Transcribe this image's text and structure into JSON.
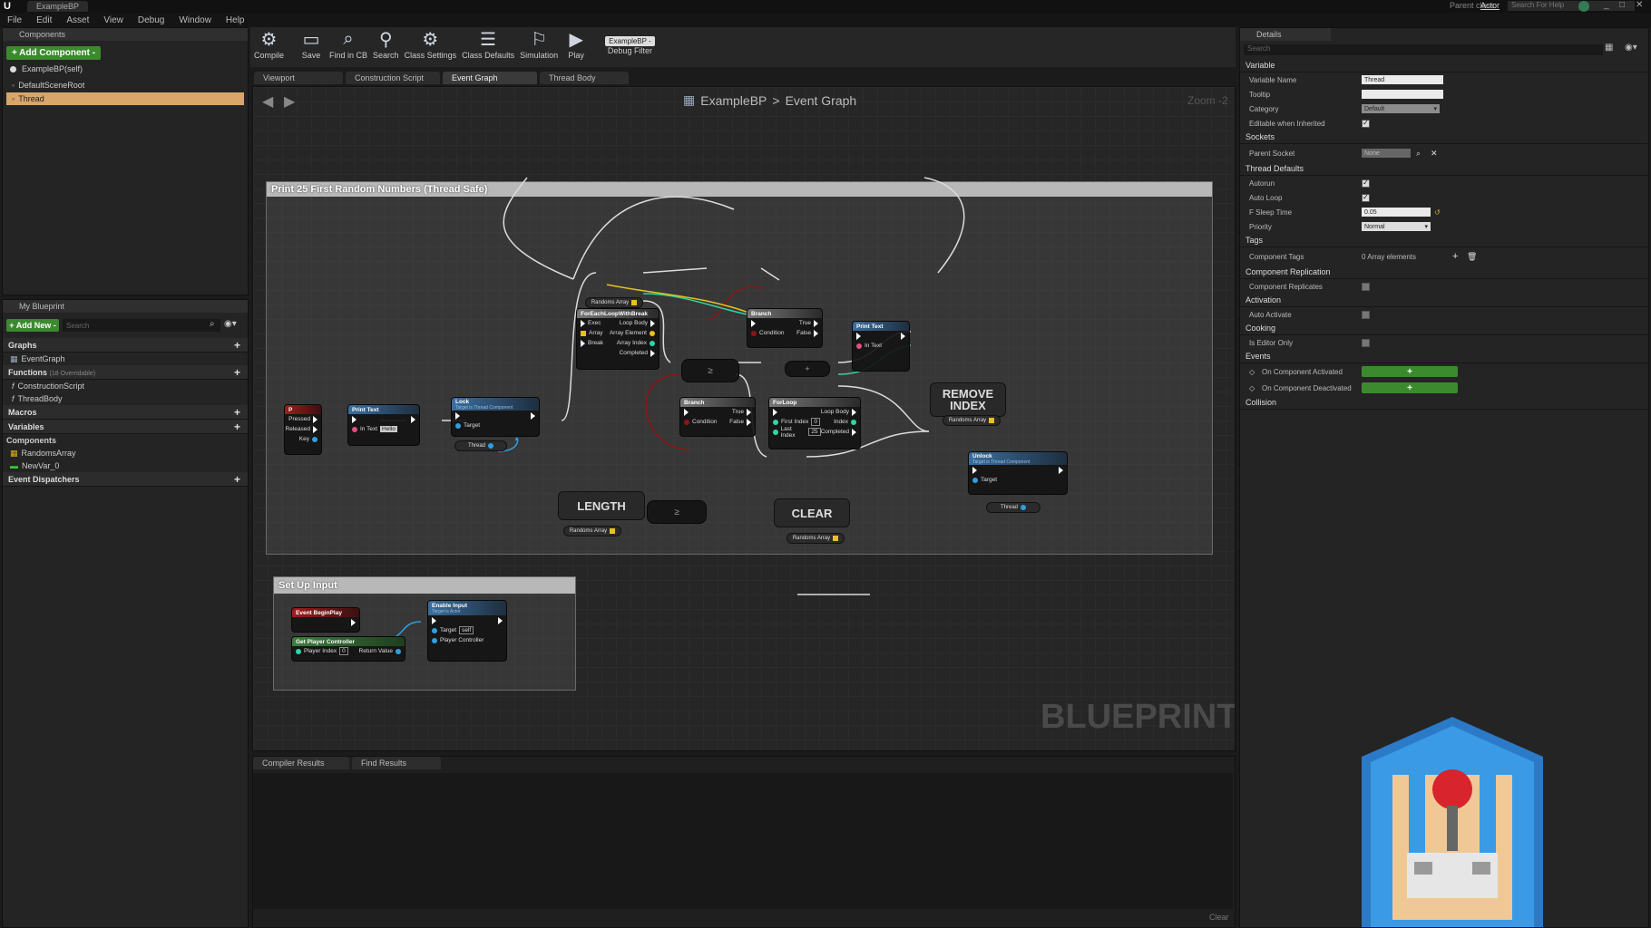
{
  "window": {
    "title": "ExampleBP",
    "parent_class_label": "Parent class:",
    "parent_class_value": "Actor",
    "help_search_placeholder": "Search For Help"
  },
  "menu": [
    "File",
    "Edit",
    "Asset",
    "View",
    "Debug",
    "Window",
    "Help"
  ],
  "components_panel": {
    "tab": "Components",
    "add_button": "+ Add Component -",
    "self_item": "ExampleBP(self)",
    "items": [
      "DefaultSceneRoot",
      "Thread"
    ]
  },
  "my_blueprint": {
    "tab": "My Blueprint",
    "add_new": "+ Add New -",
    "search_placeholder": "Search",
    "graphs_label": "Graphs",
    "graphs": [
      "EventGraph"
    ],
    "functions_label": "Functions",
    "functions_overridable": "(18 Overridable)",
    "functions": [
      "ConstructionScript",
      "ThreadBody"
    ],
    "macros_label": "Macros",
    "variables_label": "Variables",
    "components_label": "Components",
    "variables": [
      "RandomsArray",
      "NewVar_0"
    ],
    "dispatchers_label": "Event Dispatchers"
  },
  "toolbar": {
    "compile": "Compile",
    "save": "Save",
    "find_in_cb": "Find in CB",
    "search": "Search",
    "class_settings": "Class Settings",
    "class_defaults": "Class Defaults",
    "simulation": "Simulation",
    "play": "Play",
    "debug_dropdown": "ExampleBP -",
    "debug_filter": "Debug Filter"
  },
  "graph_tabs": [
    "Viewport",
    "Construction Script",
    "Event Graph",
    "Thread Body"
  ],
  "breadcrumb": {
    "bp": "ExampleBP",
    "sep": ">",
    "graph": "Event Graph",
    "zoom": "Zoom -2"
  },
  "watermark": "BLUEPRINT",
  "comments": {
    "main": "Print 25 First Random Numbers (Thread Safe)",
    "setup": "Set Up Input"
  },
  "nodes": {
    "p_key": {
      "title": "P",
      "pressed": "Pressed",
      "released": "Released",
      "key": "Key"
    },
    "print1": {
      "title": "Print Text",
      "in_text": "In Text",
      "hello": "Hello"
    },
    "lock": {
      "title": "Lock",
      "subtitle": "Target is Thread Component",
      "target": "Target",
      "thread": "Thread"
    },
    "foreach": {
      "title": "ForEachLoopWithBreak",
      "exec": "Exec",
      "array": "Array",
      "break": "Break",
      "loop_body": "Loop Body",
      "array_element": "Array Element",
      "array_index": "Array Index",
      "completed": "Completed"
    },
    "randoms_top": "Randoms Array",
    "branch1": {
      "title": "Branch",
      "condition": "Condition",
      "true": "True",
      "false": "False"
    },
    "print2": {
      "title": "Print Text",
      "in_text": "In Text"
    },
    "branch2": {
      "title": "Branch",
      "condition": "Condition",
      "true": "True",
      "false": "False"
    },
    "forloop": {
      "title": "ForLoop",
      "first_index": "First Index",
      "first_val": "0",
      "last_index": "Last Index",
      "last_val": "25",
      "loop_body": "Loop Body",
      "index": "Index",
      "completed": "Completed"
    },
    "remove_index": {
      "line1": "REMOVE",
      "line2": "INDEX"
    },
    "randoms_remove": "Randoms Array",
    "length": "LENGTH",
    "randoms_length": "Randoms Array",
    "clear": "CLEAR",
    "randoms_clear": "Randoms Array",
    "unlock": {
      "title": "Unlock",
      "subtitle": "Target is Thread Component",
      "target": "Target",
      "thread": "Thread"
    },
    "begin_play": {
      "title": "Event BeginPlay"
    },
    "get_pc": {
      "title": "Get Player Controller",
      "player_index": "Player Index",
      "player_index_val": "0",
      "return_value": "Return Value"
    },
    "enable_input": {
      "title": "Enable Input",
      "subtitle": "Target is Actor",
      "target": "Target",
      "self": "self",
      "player_controller": "Player Controller"
    }
  },
  "bottom_tabs": [
    "Compiler Results",
    "Find Results"
  ],
  "bottom_clear": "Clear",
  "details": {
    "tab": "Details",
    "search_placeholder": "Search",
    "sections": {
      "variable": "Variable",
      "sockets": "Sockets",
      "thread_defaults": "Thread Defaults",
      "tags": "Tags",
      "component_replication": "Component Replication",
      "activation": "Activation",
      "cooking": "Cooking",
      "events": "Events",
      "collision": "Collision"
    },
    "variable_name_label": "Variable Name",
    "variable_name": "Thread",
    "tooltip_label": "Tooltip",
    "category_label": "Category",
    "category": "Default",
    "editable_label": "Editable when Inherited",
    "parent_socket_label": "Parent Socket",
    "parent_socket": "None",
    "autorun_label": "Autorun",
    "autoloop_label": "Auto Loop",
    "sleep_label": "F Sleep Time",
    "sleep": "0.05",
    "priority_label": "Priority",
    "priority": "Normal",
    "component_tags_label": "Component Tags",
    "component_tags": "0 Array elements",
    "replicates_label": "Component Replicates",
    "auto_activate_label": "Auto Activate",
    "editor_only_label": "Is Editor Only",
    "on_activated": "On Component Activated",
    "on_deactivated": "On Component Deactivated"
  },
  "colors": {
    "accent_green": "#3b8a2e",
    "selection": "#d8a56a",
    "exec_wire": "#ffffff",
    "bool_red": "#8e1414"
  }
}
